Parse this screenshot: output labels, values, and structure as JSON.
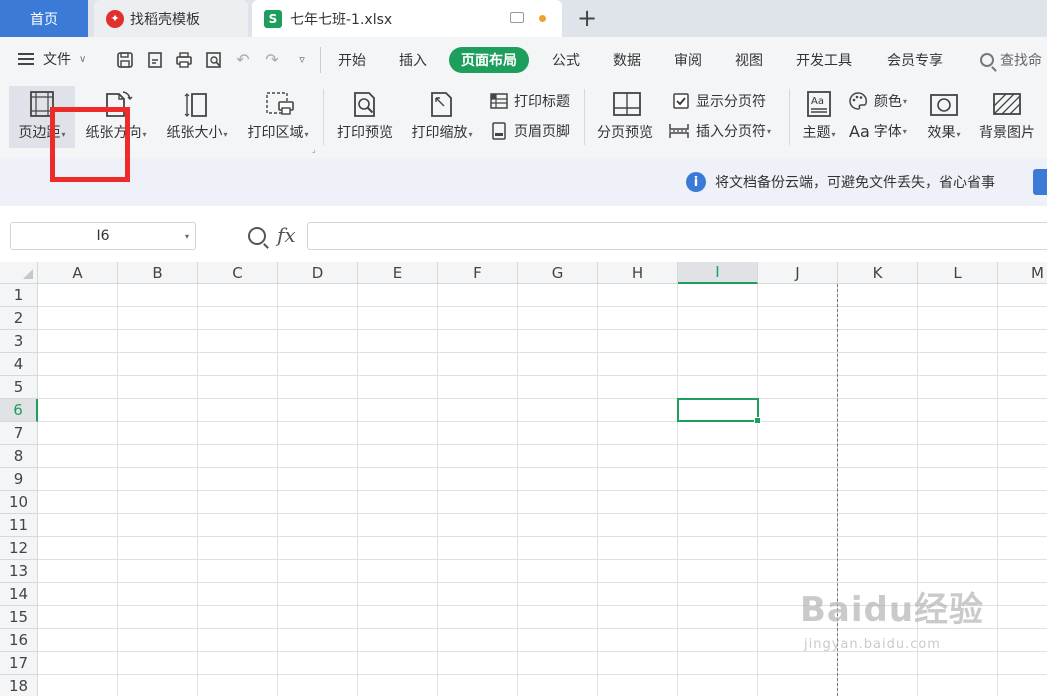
{
  "tabs": {
    "home": "首页",
    "template": "找稻壳模板",
    "file": "七年七班-1.xlsx"
  },
  "menu": {
    "file_label": "文件",
    "items": [
      "开始",
      "插入",
      "页面布局",
      "公式",
      "数据",
      "审阅",
      "视图",
      "开发工具",
      "会员专享"
    ],
    "active_item": "页面布局",
    "search_label": "查找命"
  },
  "ribbon": {
    "margins": "页边距",
    "orientation": "纸张方向",
    "size": "纸张大小",
    "print_area": "打印区域",
    "print_preview": "打印预览",
    "print_scale": "打印缩放",
    "print_titles": "打印标题",
    "header_footer": "页眉页脚",
    "page_break_preview": "分页预览",
    "show_page_breaks": "显示分页符",
    "insert_page_break": "插入分页符",
    "theme": "主题",
    "colors": "颜色",
    "fonts": "字体",
    "fonts_prefix": "Aa",
    "effects": "效果",
    "background": "背景图片"
  },
  "notification": {
    "text": "将文档备份云端，可避免文件丢失，省心省事"
  },
  "formula_bar": {
    "cell_ref": "I6",
    "fx": "fx",
    "formula": ""
  },
  "grid": {
    "columns": [
      "A",
      "B",
      "C",
      "D",
      "E",
      "F",
      "G",
      "H",
      "I",
      "J",
      "K",
      "L",
      "M"
    ],
    "rows": [
      "1",
      "2",
      "3",
      "4",
      "5",
      "6",
      "7",
      "8",
      "9",
      "10",
      "11",
      "12",
      "13",
      "14",
      "15",
      "16",
      "17",
      "18"
    ],
    "active_column": "I",
    "active_row": "6"
  },
  "watermark": {
    "main": "Baidu经验",
    "sub": "jingyan.baidu.com"
  },
  "colors": {
    "accent_green": "#1e9e5c",
    "home_tab_blue": "#3b7bd7",
    "highlight_red": "#ee2a2a"
  }
}
